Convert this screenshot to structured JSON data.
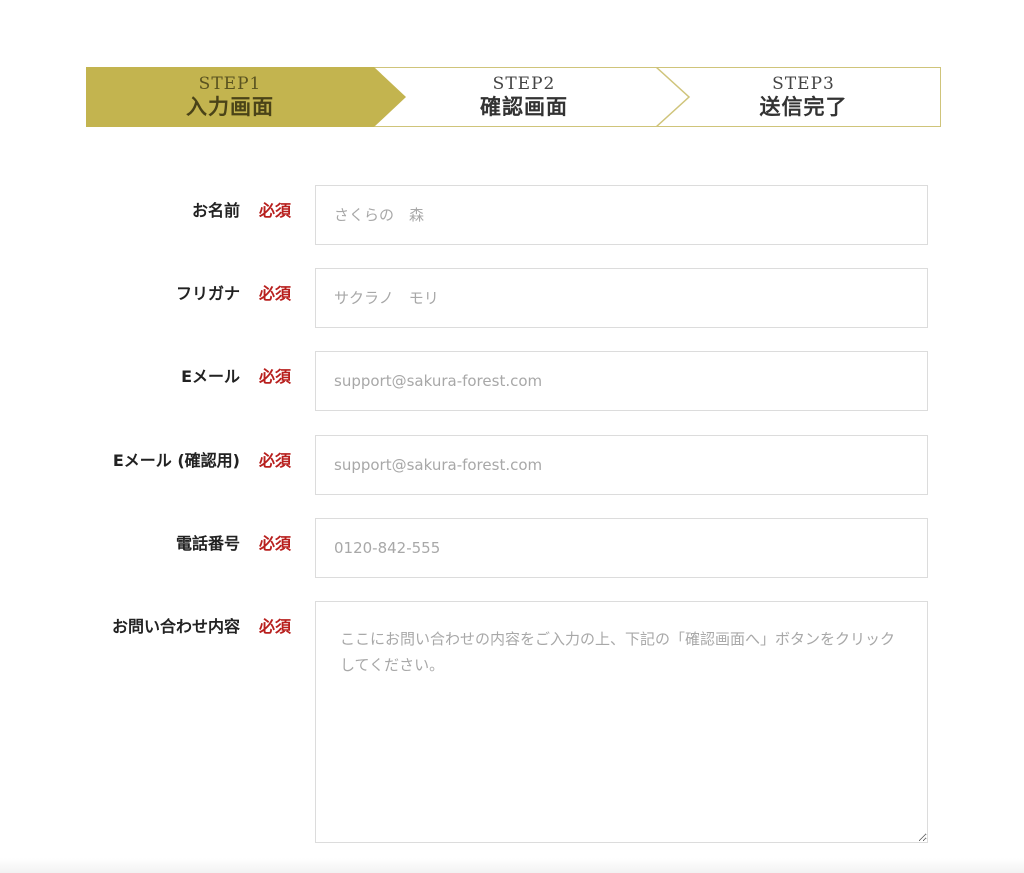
{
  "colors": {
    "accent": "#c3b44f",
    "accent_border": "#cfc47a",
    "required": "#b8201e",
    "field_border": "#dcdcdc"
  },
  "steps": [
    {
      "en": "STEP1",
      "jp": "入力画面",
      "active": true
    },
    {
      "en": "STEP2",
      "jp": "確認画面",
      "active": false
    },
    {
      "en": "STEP3",
      "jp": "送信完了",
      "active": false
    }
  ],
  "form": {
    "required_label": "必須",
    "fields": [
      {
        "label": "お名前",
        "placeholder": "さくらの　森"
      },
      {
        "label": "フリガナ",
        "placeholder": "サクラノ　モリ"
      },
      {
        "label": "Eメール",
        "placeholder": "support@sakura-forest.com"
      },
      {
        "label": "Eメール (確認用)",
        "placeholder": "support@sakura-forest.com"
      },
      {
        "label": "電話番号",
        "placeholder": "0120-842-555"
      },
      {
        "label": "お問い合わせ内容",
        "placeholder": "ここにお問い合わせの内容をご入力の上、下記の「確認画面へ」ボタンをクリックしてください。"
      }
    ]
  }
}
